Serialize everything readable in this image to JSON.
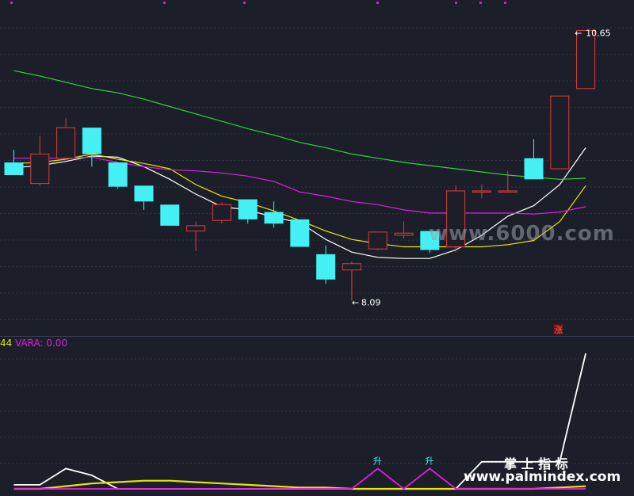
{
  "chart_data": [
    {
      "type": "candlestick",
      "panel": "price",
      "grid": true,
      "ylim": [
        7.8,
        10.85
      ],
      "candles": [
        {
          "o": 9.4,
          "h": 9.52,
          "l": 9.28,
          "c": 9.28
        },
        {
          "o": 9.2,
          "h": 9.65,
          "l": 9.18,
          "c": 9.48
        },
        {
          "o": 9.44,
          "h": 9.82,
          "l": 9.42,
          "c": 9.73
        },
        {
          "o": 9.73,
          "h": 9.73,
          "l": 9.36,
          "c": 9.48
        },
        {
          "o": 9.4,
          "h": 9.4,
          "l": 9.15,
          "c": 9.17
        },
        {
          "o": 9.18,
          "h": 9.18,
          "l": 8.95,
          "c": 9.03
        },
        {
          "o": 9.0,
          "h": 9.0,
          "l": 8.8,
          "c": 8.8
        },
        {
          "o": 8.75,
          "h": 8.84,
          "l": 8.56,
          "c": 8.8
        },
        {
          "o": 8.85,
          "h": 9.02,
          "l": 8.82,
          "c": 9.0
        },
        {
          "o": 9.05,
          "h": 9.05,
          "l": 8.82,
          "c": 8.86
        },
        {
          "o": 8.93,
          "h": 9.03,
          "l": 8.78,
          "c": 8.82
        },
        {
          "o": 8.86,
          "h": 8.86,
          "l": 8.6,
          "c": 8.6
        },
        {
          "o": 8.53,
          "h": 8.61,
          "l": 8.25,
          "c": 8.29
        },
        {
          "o": 8.38,
          "h": 8.46,
          "l": 8.09,
          "c": 8.44
        },
        {
          "o": 8.58,
          "h": 8.74,
          "l": 8.57,
          "c": 8.74
        },
        {
          "o": 8.71,
          "h": 8.84,
          "l": 8.68,
          "c": 8.73
        },
        {
          "o": 8.75,
          "h": 8.75,
          "l": 8.54,
          "c": 8.57
        },
        {
          "o": 8.6,
          "h": 9.18,
          "l": 8.55,
          "c": 9.13
        },
        {
          "o": 9.13,
          "h": 9.19,
          "l": 9.06,
          "c": 9.13
        },
        {
          "o": 9.13,
          "h": 9.32,
          "l": 9.13,
          "c": 9.13
        },
        {
          "o": 9.44,
          "h": 9.62,
          "l": 9.24,
          "c": 9.24
        },
        {
          "o": 9.34,
          "h": 10.03,
          "l": 9.34,
          "c": 10.03
        },
        {
          "o": 10.1,
          "h": 10.65,
          "l": 10.1,
          "c": 10.65
        }
      ],
      "ma_series": [
        {
          "color": "#ffffff",
          "values": [
            9.35,
            9.37,
            9.41,
            9.46,
            9.45,
            9.36,
            9.24,
            9.1,
            8.98,
            8.95,
            8.88,
            8.83,
            8.67,
            8.55,
            8.5,
            8.49,
            8.49,
            8.57,
            8.71,
            8.89,
            8.99,
            9.19,
            9.54
          ]
        },
        {
          "color": "#e6e600",
          "values": [
            9.39,
            9.4,
            9.43,
            9.48,
            9.43,
            9.39,
            9.34,
            9.19,
            9.08,
            9.02,
            8.94,
            8.85,
            8.75,
            8.67,
            8.63,
            8.6,
            8.6,
            8.6,
            8.6,
            8.62,
            8.66,
            8.84,
            9.18
          ]
        },
        {
          "color": "#e01ee0",
          "values": [
            9.44,
            9.44,
            9.44,
            9.45,
            9.4,
            9.36,
            9.33,
            9.32,
            9.3,
            9.27,
            9.22,
            9.12,
            9.08,
            9.03,
            9.0,
            8.95,
            8.92,
            8.92,
            8.92,
            8.92,
            8.91,
            8.93,
            8.98
          ]
        },
        {
          "color": "#2ed43a",
          "values": [
            10.27,
            10.22,
            10.16,
            10.1,
            10.06,
            10.0,
            9.93,
            9.86,
            9.79,
            9.72,
            9.66,
            9.59,
            9.54,
            9.48,
            9.44,
            9.4,
            9.37,
            9.34,
            9.31,
            9.28,
            9.26,
            9.24,
            9.25
          ]
        }
      ],
      "annotations": [
        {
          "text": "10.65",
          "candle": 22,
          "value": 10.65
        },
        {
          "text": "8.09",
          "candle": 13,
          "value": 8.09
        },
        {
          "text": "涨",
          "candle": 21
        }
      ]
    },
    {
      "type": "line",
      "panel": "indicator",
      "legend": [
        {
          "text": "44",
          "color": "#e6e600"
        },
        {
          "text": "VARA: 0.00",
          "color": "#e01ee0"
        }
      ],
      "ylim": [
        0,
        1.0
      ],
      "series": [
        {
          "color": "#ffffff",
          "values": [
            0.03,
            0.03,
            0.15,
            0.1,
            0.0,
            0.0,
            0.0,
            0.0,
            0.0,
            0.0,
            0.0,
            0.0,
            0.0,
            0.0,
            0.0,
            0.0,
            0.0,
            0.0,
            0.2,
            0.2,
            0.2,
            0.2,
            1.0
          ]
        },
        {
          "color": "#e6e600",
          "values": [
            0.0,
            0.0,
            0.02,
            0.04,
            0.05,
            0.06,
            0.06,
            0.05,
            0.04,
            0.03,
            0.02,
            0.01,
            0.01,
            0.0,
            0.0,
            0.0,
            0.0,
            0.0,
            0.0,
            0.0,
            0.0,
            0.01,
            0.02
          ]
        },
        {
          "color": "#e01ee0",
          "values": [
            0.0,
            0.0,
            0.0,
            0.0,
            0.0,
            0.0,
            0.0,
            0.0,
            0.0,
            0.0,
            0.0,
            0.0,
            0.0,
            0.0,
            0.15,
            0.0,
            0.15,
            0.0,
            0.0,
            0.0,
            0.0,
            0.0,
            0.0
          ]
        }
      ],
      "markers": [
        {
          "text": "升",
          "index": 14
        },
        {
          "text": "升",
          "index": 16
        }
      ]
    }
  ],
  "watermarks": [
    {
      "text": "www.6000.com"
    },
    {
      "text": "掌 上 指 标"
    },
    {
      "text": "www.palmindex.com"
    }
  ],
  "colors": {
    "background": "#1c1f2a",
    "grid": "#2f3448",
    "up": "#e23b3b",
    "down": "#44f0f4",
    "separator": "#3a3f55"
  }
}
